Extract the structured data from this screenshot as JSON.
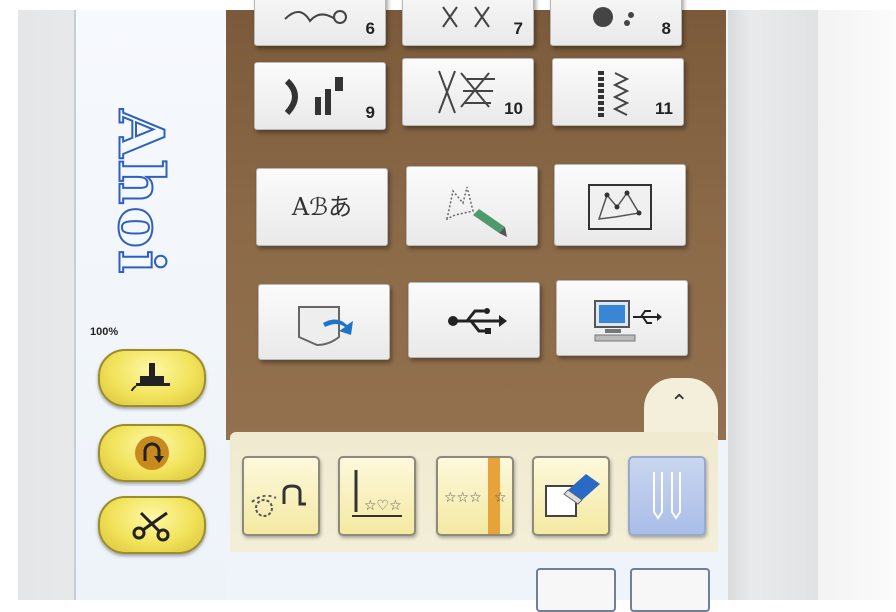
{
  "preview": {
    "text": "Ahoi"
  },
  "status": {
    "zoom": "100%"
  },
  "side_buttons": [
    {
      "name": "presser-foot",
      "icon": "presser-foot-icon"
    },
    {
      "name": "reverse",
      "icon": "reverse-stitch-icon"
    },
    {
      "name": "thread-cutter",
      "icon": "scissors-icon"
    }
  ],
  "categories": [
    {
      "number": "6"
    },
    {
      "number": "7"
    },
    {
      "number": "8"
    },
    {
      "number": "9"
    },
    {
      "number": "10"
    },
    {
      "number": "11"
    },
    {
      "label": "Aℬあ",
      "icon": "character-fonts-icon"
    },
    {
      "icon": "my-custom-stitch-icon"
    },
    {
      "icon": "stitch-design-icon"
    },
    {
      "icon": "machine-memory-icon"
    },
    {
      "icon": "usb-icon"
    },
    {
      "icon": "computer-usb-icon"
    }
  ],
  "toolbar": {
    "collapse_icon": "chevron-double-up-icon",
    "tools": [
      {
        "icon": "start-point-icon",
        "active": false
      },
      {
        "icon": "needle-pattern-icon",
        "active": false
      },
      {
        "icon": "pattern-select-icon",
        "active": false
      },
      {
        "icon": "eraser-icon",
        "active": false
      },
      {
        "icon": "twin-needle-icon",
        "active": true
      }
    ]
  },
  "colors": {
    "background_brown": "#8b6a48",
    "button_yellow": "#f1e35a",
    "active_blue": "#a9bde8",
    "preview_blue": "#2f5fbf"
  }
}
